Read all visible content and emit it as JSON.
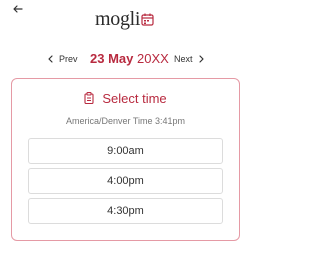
{
  "header": {
    "back_icon": "arrow-left-icon",
    "logo_text": "mogli",
    "logo_icon": "calendar-icon"
  },
  "date_nav": {
    "prev_label": "Prev",
    "next_label": "Next",
    "day_month": "23 May",
    "year": "20XX"
  },
  "panel": {
    "icon": "clipboard-icon",
    "title": "Select time",
    "timezone_text": "America/Denver Time 3:41pm",
    "slots": [
      "9:00am",
      "4:00pm",
      "4:30pm"
    ]
  },
  "colors": {
    "accent": "#b82a3f",
    "border": "#e59aa5"
  }
}
